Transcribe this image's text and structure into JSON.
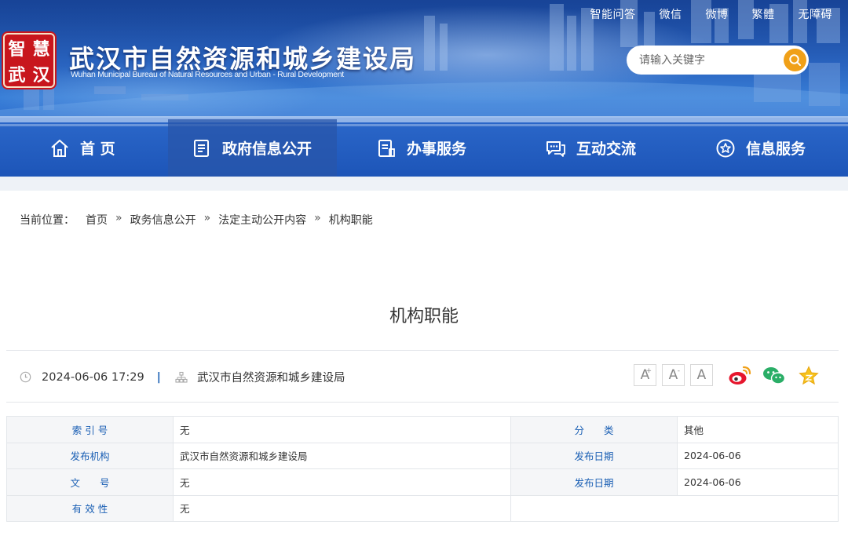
{
  "header": {
    "logo_chars": [
      "智",
      "慧",
      "武",
      "汉"
    ],
    "site_title": "武汉市自然资源和城乡建设局",
    "site_subtitle": "Wuhan Municipal Bureau of Natural Resources and Urban - Rural Development",
    "top_links": [
      "智能问答",
      "微信",
      "微博",
      "繁體",
      "无障碍"
    ],
    "search": {
      "placeholder": "请输入关键字",
      "icon": "search-icon"
    }
  },
  "nav": {
    "items": [
      {
        "label": "首 页",
        "icon": "home-icon",
        "active": false
      },
      {
        "label": "政府信息公开",
        "icon": "document-icon",
        "active": true
      },
      {
        "label": "办事服务",
        "icon": "service-doc-icon",
        "active": false
      },
      {
        "label": "互动交流",
        "icon": "chat-icon",
        "active": false
      },
      {
        "label": "信息服务",
        "icon": "star-circle-icon",
        "active": false
      }
    ]
  },
  "breadcrumb": {
    "prefix": "当前位置：",
    "items": [
      "首页",
      "政务信息公开",
      "法定主动公开内容",
      "机构职能"
    ],
    "separator": "»"
  },
  "article": {
    "title": "机构职能",
    "datetime": "2024-06-06 17:29",
    "divider": "|",
    "source": "武汉市自然资源和城乡建设局",
    "font_sizes": [
      "A",
      "A",
      "A"
    ],
    "share_icons": [
      "weibo-icon",
      "wechat-icon",
      "favorite-star-icon"
    ]
  },
  "info_table": {
    "rows": [
      {
        "k1": "索 引 号",
        "v1": "无",
        "k2": "分　　类",
        "v2": "其他"
      },
      {
        "k1": "发布机构",
        "v1": "武汉市自然资源和城乡建设局",
        "k2": "发布日期",
        "v2": "2024-06-06"
      },
      {
        "k1": "文　　号",
        "v1": "无",
        "k2": "发布日期",
        "v2": "2024-06-06"
      },
      {
        "k1": "有 效 性",
        "v1": "无",
        "k2": "",
        "v2": ""
      }
    ]
  },
  "colors": {
    "primary": "#1a5fb4",
    "accent": "#f0a018",
    "logo_red": "#c8161d"
  }
}
